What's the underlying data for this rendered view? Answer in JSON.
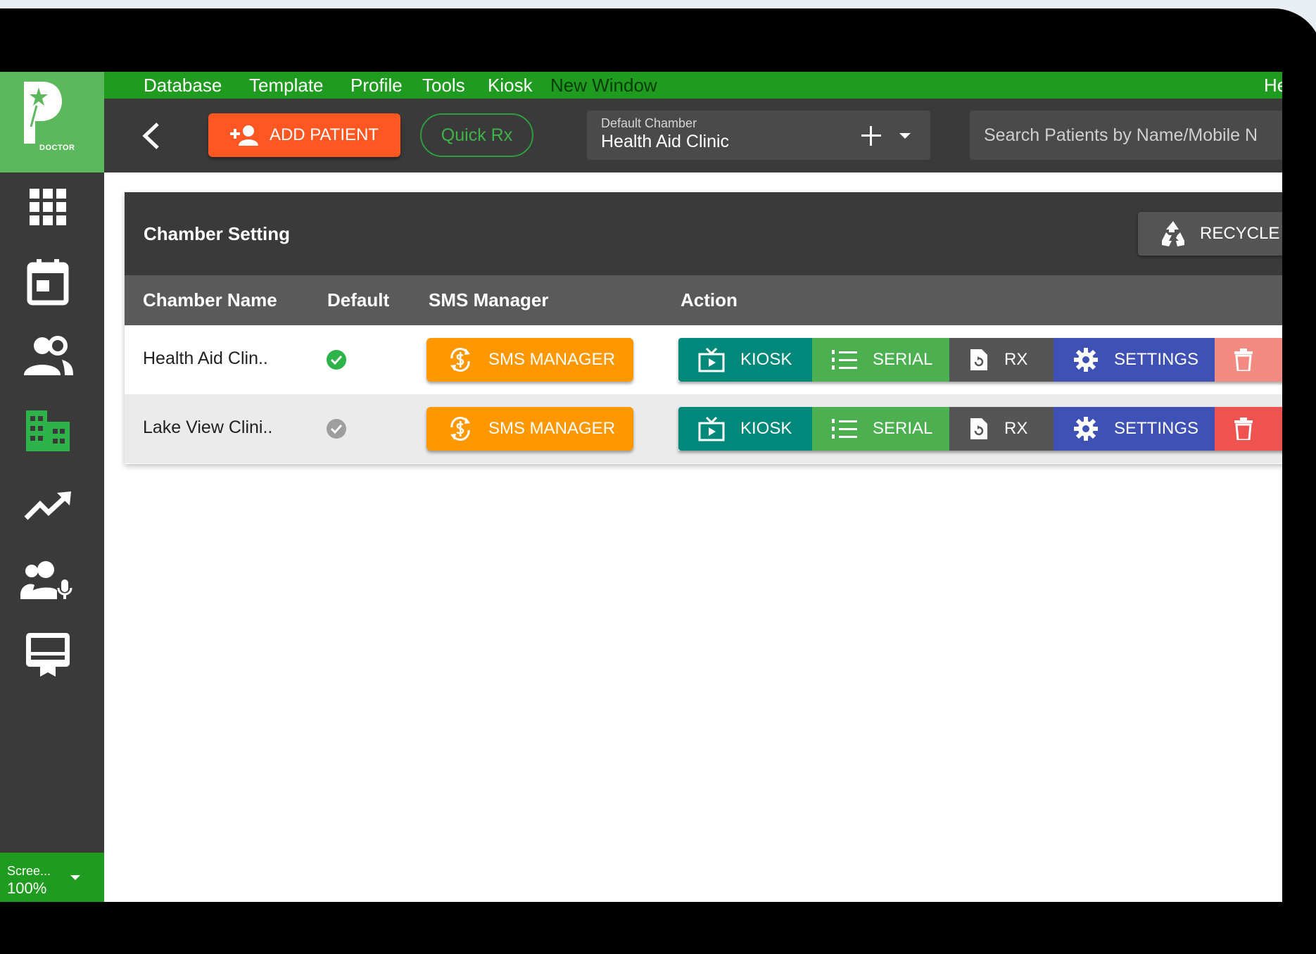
{
  "menu": {
    "items": [
      "Database",
      "Template",
      "Profile",
      "Tools",
      "Kiosk",
      "New Window"
    ],
    "help_partial": "He"
  },
  "logo": {
    "text": "DOCTOR"
  },
  "sidebar": {
    "icons": [
      "dashboard-grid-icon",
      "calendar-icon",
      "patients-icon",
      "chamber-building-icon",
      "trending-chart-icon",
      "assistants-icon",
      "kiosk-display-icon"
    ],
    "active": "chamber-building-icon",
    "zoom_label": "Scree...",
    "zoom_value": "100%"
  },
  "toolbar": {
    "add_patient_label": "ADD PATIENT",
    "quick_rx_label": "Quick Rx",
    "chamber_label": "Default Chamber",
    "chamber_value": "Health Aid Clinic",
    "search_placeholder": "Search Patients by Name/Mobile N"
  },
  "card": {
    "title": "Chamber Setting",
    "recycle_label": "RECYCLE I",
    "columns": [
      "Chamber Name",
      "Default",
      "SMS Manager",
      "Action"
    ],
    "rows": [
      {
        "name": "Health Aid Clin..",
        "is_default": true
      },
      {
        "name": "Lake View Clini..",
        "is_default": false
      }
    ],
    "sms_label": "SMS MANAGER",
    "actions": {
      "kiosk": "KIOSK",
      "serial": "SERIAL",
      "rx": "RX",
      "settings": "SETTINGS"
    }
  },
  "colors": {
    "brand_green": "#1f9b1f",
    "add_patient": "#ff5722",
    "sms": "#ff9800",
    "kiosk": "#00897b",
    "serial": "#4caf50",
    "settings": "#3f51b5",
    "delete": "#ef5350"
  }
}
